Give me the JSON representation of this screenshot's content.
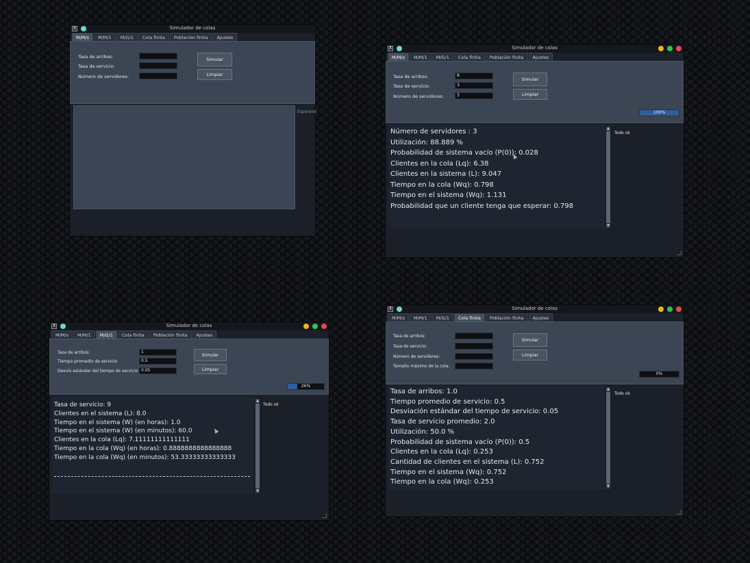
{
  "colors": {
    "accent": "#2f5f98",
    "light_yellow": "#e8b61d",
    "light_green": "#2dc653",
    "light_red": "#e5484d",
    "teal": "#70d6c9"
  },
  "windows": {
    "w1": {
      "title": "Simulador de colas",
      "tabs": [
        "M/M/s",
        "M/M/1",
        "M/G/1",
        "Cola finita",
        "Población finita",
        "Ajustes"
      ],
      "active_tab": 0,
      "fields": [
        {
          "label": "Tasa de arribos:",
          "value": ""
        },
        {
          "label": "Tasa de servicio:",
          "value": ""
        },
        {
          "label": "Número de servidores:",
          "value": ""
        }
      ],
      "simulate": "Simular",
      "clear": "Limpiar",
      "side_text": "Esperand"
    },
    "w2": {
      "title": "Simulador de colas",
      "tabs": [
        "M/M/s",
        "M/M/1",
        "M/G/1",
        "Cola finita",
        "Población finita",
        "Ajustes"
      ],
      "active_tab": 0,
      "fields": [
        {
          "label": "Tasa de arribos:",
          "value": "8"
        },
        {
          "label": "Tasa de servicio:",
          "value": "3"
        },
        {
          "label": "Número de servidores:",
          "value": "3"
        }
      ],
      "simulate": "Simular",
      "clear": "Limpiar",
      "progress": {
        "value": 1.0,
        "text": "100%"
      },
      "output": [
        "Número de servidores : 3",
        "Utilización: 88.889 %",
        "Probabilidad de sistema vacío (P(0)): 0.028",
        "Clientes en la cola (Lq): 6.38",
        "Clientes en la sistema (L): 9.047",
        "Tiempo en la cola (Wq): 0.798",
        "Tiempo en el sistema (Wq): 1.131",
        "Probabilidad que un cliente tenga que esperar: 0.798"
      ],
      "status": "Todo ok"
    },
    "w3": {
      "title": "Simulador de colas",
      "tabs": [
        "M/M/s",
        "M/M/1",
        "M/G/1",
        "Cola finita",
        "Población finita",
        "Ajustes"
      ],
      "active_tab": 2,
      "fields": [
        {
          "label": "Tasa de arribos:",
          "value": "1"
        },
        {
          "label": "Tiempo promedio de servicio",
          "value": "0.5"
        },
        {
          "label": "Desvío estándar del tiempo de servicio",
          "value": "0.05"
        }
      ],
      "simulate": "Simular",
      "clear": "Limpiar",
      "progress": {
        "value": 0.26,
        "text": "26%"
      },
      "output": [
        "Tasa de servicio: 9",
        "Clientes en el sistema (L): 8.0",
        "Tiempo en el sistema (W) (en horas): 1.0",
        "Tiempo en el sistema (W) (en minutos): 60.0",
        "Clientes en la cola (Lq): 7.11111111111111",
        "Tiempo en la cola (Wq) (en horas): 0.8888888888888888",
        "Tiempo en la cola (Wq) (en minutos): 53.33333333333333"
      ],
      "status": "Todo ok"
    },
    "w4": {
      "title": "Simulador de colas",
      "tabs": [
        "M/M/s",
        "M/M/1",
        "M/G/1",
        "Cola finita",
        "Población finita",
        "Ajustes"
      ],
      "active_tab": 3,
      "fields": [
        {
          "label": "Tasa de arribos:",
          "value": ""
        },
        {
          "label": "Tasa de servicio:",
          "value": ""
        },
        {
          "label": "Número de servidores:",
          "value": ""
        },
        {
          "label": "Tamaño máximo de la cola:",
          "value": ""
        }
      ],
      "simulate": "Simular",
      "clear": "Limpiar",
      "progress": {
        "value": 0.0,
        "text": "0%"
      },
      "output": [
        "Tasa de arribos: 1.0",
        "Tiempo promedio de servicio: 0.5",
        "Desviación estándar del tiempo de servicio: 0.05",
        "Tasa de servicio promedio: 2.0",
        "Utilización: 50.0 %",
        "Probabilidad de sistema vacío (P(0)): 0.5",
        "Clientes en la cola (Lq): 0.253",
        "Cantidad de clientes en el sistema (L): 0.752",
        "Tiempo en el sistema (Wq): 0.752",
        "Tiempo en la cola (Wq): 0.253"
      ],
      "status": "Todo ok"
    }
  }
}
